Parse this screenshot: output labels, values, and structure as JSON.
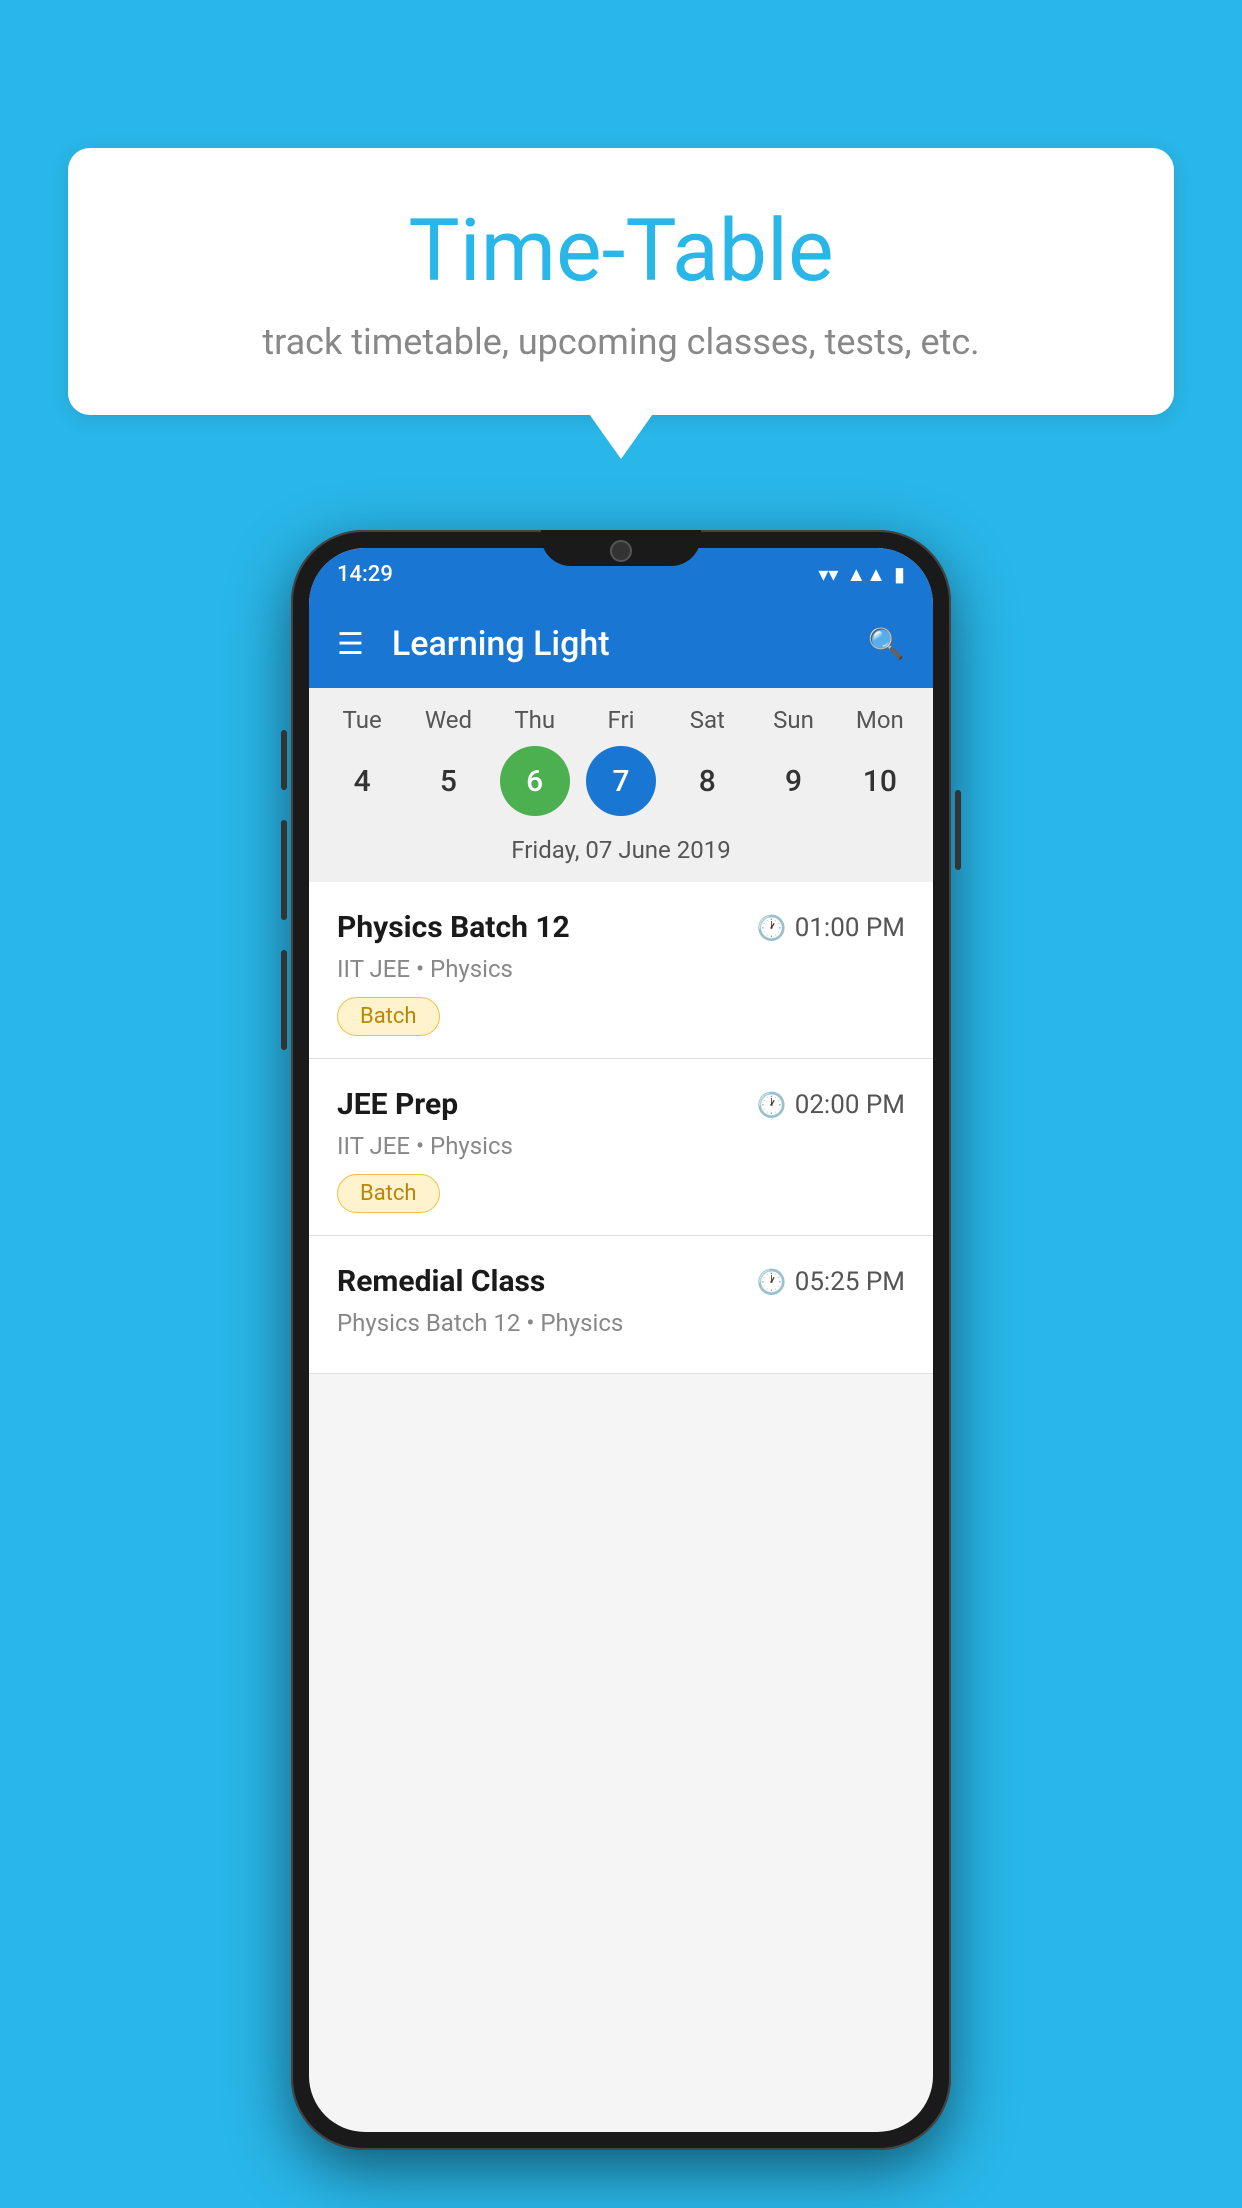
{
  "background_color": "#29B6E8",
  "speech_bubble": {
    "title": "Time-Table",
    "subtitle": "track timetable, upcoming classes, tests, etc."
  },
  "phone": {
    "status_bar": {
      "time": "14:29"
    },
    "app_bar": {
      "title": "Learning Light"
    },
    "calendar": {
      "days": [
        {
          "label": "Tue",
          "number": "4"
        },
        {
          "label": "Wed",
          "number": "5"
        },
        {
          "label": "Thu",
          "number": "6",
          "state": "today"
        },
        {
          "label": "Fri",
          "number": "7",
          "state": "selected"
        },
        {
          "label": "Sat",
          "number": "8"
        },
        {
          "label": "Sun",
          "number": "9"
        },
        {
          "label": "Mon",
          "number": "10"
        }
      ],
      "selected_date_label": "Friday, 07 June 2019"
    },
    "schedule_items": [
      {
        "title": "Physics Batch 12",
        "time": "01:00 PM",
        "subtitle": "IIT JEE • Physics",
        "badge": "Batch"
      },
      {
        "title": "JEE Prep",
        "time": "02:00 PM",
        "subtitle": "IIT JEE • Physics",
        "badge": "Batch"
      },
      {
        "title": "Remedial Class",
        "time": "05:25 PM",
        "subtitle": "Physics Batch 12 • Physics",
        "badge": null
      }
    ]
  }
}
